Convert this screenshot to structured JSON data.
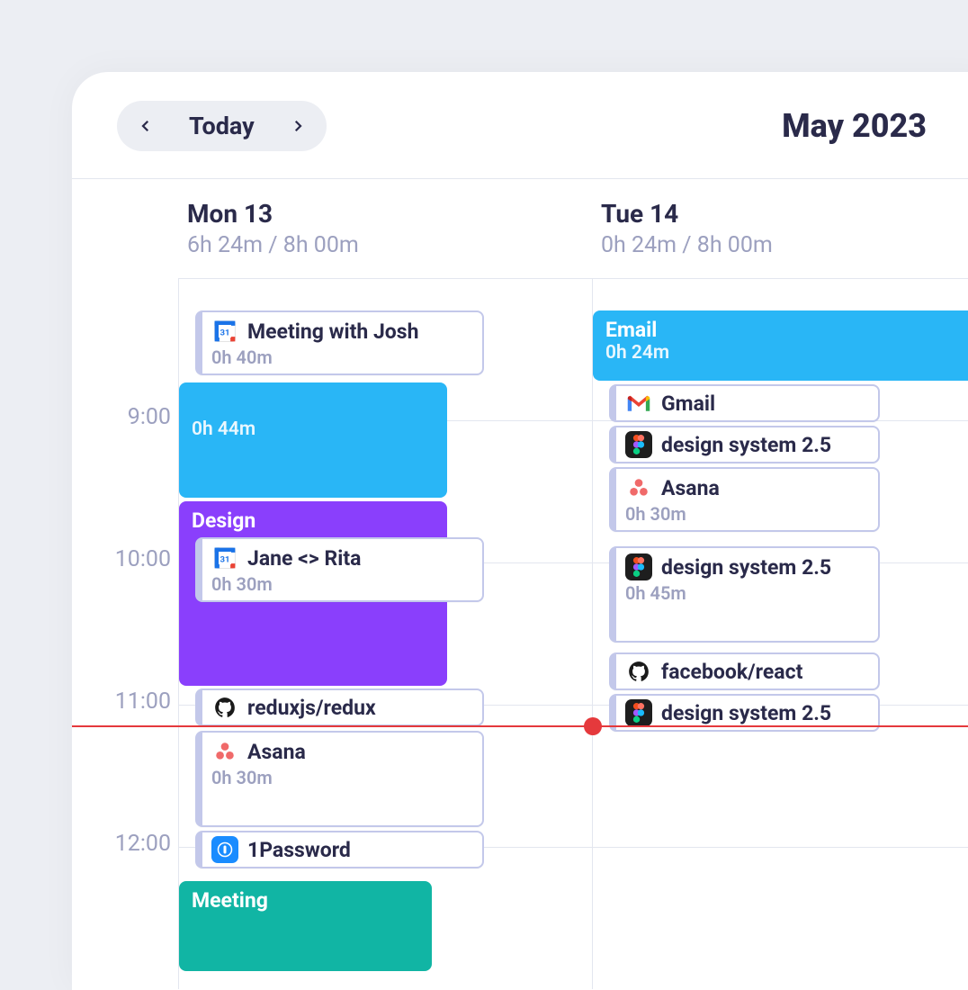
{
  "header": {
    "today_label": "Today",
    "month": "May 2023"
  },
  "days": [
    {
      "label": "Mon 13",
      "hours": "6h 24m / 8h 00m"
    },
    {
      "label": "Tue 14",
      "hours": "0h 24m / 8h 00m"
    }
  ],
  "time_labels": [
    "9:00",
    "10:00",
    "11:00",
    "12:00"
  ],
  "colors": {
    "email": "#29B6F6",
    "design": "#8A3FFC",
    "meeting": "#11B5A4"
  },
  "mon": {
    "block1_dur": "0h 44m",
    "meeting_josh": "Meeting with Josh",
    "meeting_josh_dur": "0h 40m",
    "design_label": "Design",
    "jane_rita": "Jane <> Rita",
    "jane_rita_dur": "0h 30m",
    "redux": "reduxjs/redux",
    "asana": "Asana",
    "asana_dur": "0h 30m",
    "onepw": "1Password",
    "meeting_label": "Meeting"
  },
  "tue": {
    "email_label": "Email",
    "email_dur": "0h 24m",
    "gmail": "Gmail",
    "ds1": "design system 2.5",
    "asana": "Asana",
    "asana_dur": "0h 30m",
    "ds2": "design system 2.5",
    "ds2_dur": "0h 45m",
    "react": "facebook/react",
    "ds3": "design system 2.5"
  }
}
